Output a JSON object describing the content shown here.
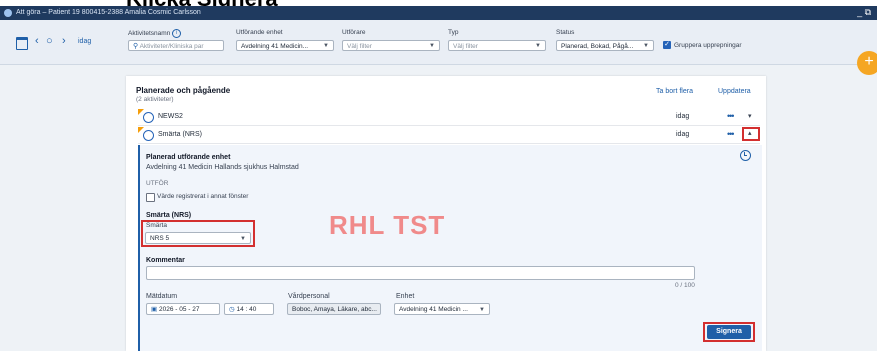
{
  "instruction": {
    "step_title": "Klicka Signera"
  },
  "titlebar": {
    "text": "Att göra – Patient 19 800415-2388 Amalia Cosmic Carlsson",
    "window_controls": "_ ⧉"
  },
  "toolbar": {
    "date_nav": {
      "prev": "‹",
      "today_circle": "○",
      "next": "›",
      "label": "idag"
    },
    "activity_name": {
      "label": "Aktivitetsnamn",
      "placeholder": "Aktiviteter/Kliniska par"
    },
    "executing_unit": {
      "label": "Utförande enhet",
      "value": "Avdelning 41 Medicin..."
    },
    "performer": {
      "label": "Utförare",
      "placeholder": "Välj filter"
    },
    "type": {
      "label": "Typ",
      "placeholder": "Välj filter"
    },
    "status": {
      "label": "Status",
      "value": "Planerad, Bokad, Pågå..."
    },
    "group_repeats": {
      "label": "Gruppera upprepningar",
      "checked": true
    },
    "add_button": "+"
  },
  "panel": {
    "title": "Planerade och pågående",
    "subtitle": "(2 aktiviteter)",
    "remove_many": "Ta bort flera",
    "update": "Uppdatera",
    "rows": [
      {
        "name": "NEWS2",
        "date": "idag",
        "more": "•••",
        "toggle": "▾"
      },
      {
        "name": "Smärta (NRS)",
        "date": "idag",
        "more": "•••",
        "toggle": "▴"
      }
    ]
  },
  "detail": {
    "planned_unit_label": "Planerad utförande enhet",
    "planned_unit_value": "Avdelning 41 Medicin Hallands sjukhus Halmstad",
    "performed_label": "UTFÖR",
    "registered_elsewhere": "Värde registrerat i annat fönster",
    "section_title": "Smärta (NRS)",
    "pain_label": "Smärta",
    "pain_value": "NRS 5",
    "watermark": "RHL TST",
    "comment_label": "Kommentar",
    "comment_value": "",
    "comment_counter": "0 / 100",
    "measure_date_label": "Mätdatum",
    "measure_date_value": "2026 - 05 - 27",
    "time_value": "14 : 40",
    "care_staff_label": "Vårdpersonal",
    "care_staff_value": "Boboc, Amaya, Läkare, abc...",
    "unit_label": "Enhet",
    "unit_value": "Avdelning 41 Medicin ...",
    "sign_button": "Signera"
  },
  "colors": {
    "accent": "#1f5fa8",
    "highlight": "#d32f2f",
    "flag": "#f59e0b",
    "fab": "#f5a623",
    "titlebar": "#1f3a5f"
  }
}
